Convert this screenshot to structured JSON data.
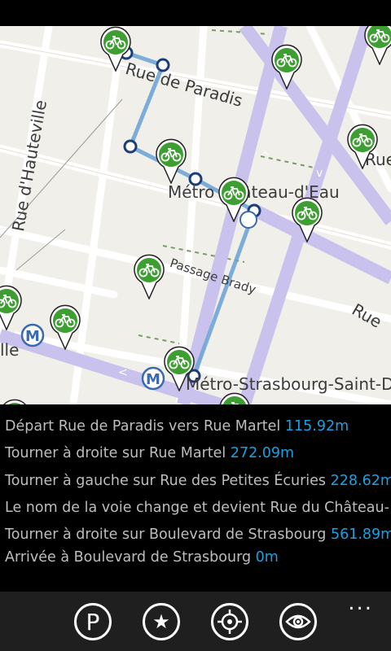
{
  "map": {
    "streets": {
      "rue_de_paradis": "Rue de Paradis",
      "rue_hauteville": "Rue d'Hauteville",
      "metro_label": "Métro Château-d'Eau",
      "passage_brady": "Passage Brady",
      "rue_right": "Rue",
      "rue_far_right": "Rue",
      "lle": "lle",
      "metro_strasbourg": "Métro-Strasbourg-Saint-Denis"
    },
    "icons": {
      "bike_station": "bicycle-icon",
      "metro": "metro-icon"
    },
    "colors": {
      "route": "#5b9bd5",
      "bike_pin": "#3d9f31",
      "boulevard": "#c8c2ec"
    }
  },
  "directions": [
    {
      "text": "Départ Rue de Paradis vers Rue Martel",
      "distance": "115.92m"
    },
    {
      "text": "Tourner à droite sur Rue Martel",
      "distance": "272.09m"
    },
    {
      "text": "Tourner à gauche sur Rue des Petites Écuries",
      "distance": "228.62m"
    },
    {
      "text": "Le nom de la voie change et devient Rue du Château-",
      "distance": ""
    },
    {
      "text": "Tourner à droite sur Boulevard de Strasbourg",
      "distance": "561.89m"
    },
    {
      "text": "Arrivée à Boulevard de Strasbourg",
      "distance": "0m"
    }
  ],
  "appbar": {
    "buttons": [
      {
        "icon": "parking-icon",
        "glyph": "P"
      },
      {
        "icon": "star-icon",
        "glyph": "★"
      },
      {
        "icon": "locate-icon",
        "glyph": ""
      },
      {
        "icon": "eye-icon",
        "glyph": ""
      }
    ],
    "more": "..."
  },
  "accent_color": "#1ba1e2"
}
